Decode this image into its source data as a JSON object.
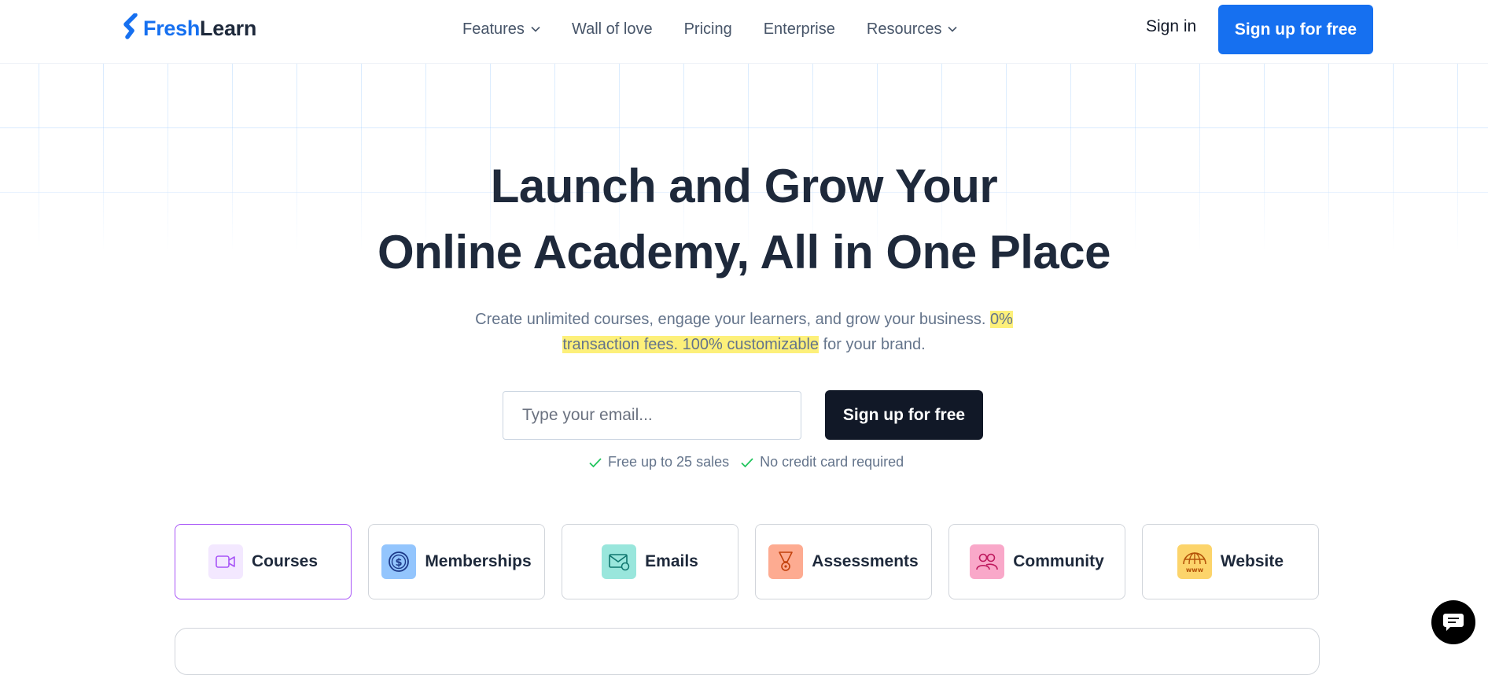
{
  "brand": {
    "name_part1": "Fresh",
    "name_part2": "Learn",
    "primary_color": "#1670f0",
    "dark_color": "#1e293b"
  },
  "nav": {
    "items": [
      {
        "label": "Features",
        "has_dropdown": true
      },
      {
        "label": "Wall of love",
        "has_dropdown": false
      },
      {
        "label": "Pricing",
        "has_dropdown": false
      },
      {
        "label": "Enterprise",
        "has_dropdown": false
      },
      {
        "label": "Resources",
        "has_dropdown": true
      }
    ],
    "sign_in": "Sign in",
    "cta": "Sign up for free"
  },
  "hero": {
    "title_line1": "Launch and Grow Your",
    "title_line2": "Online Academy, All in One Place",
    "subtitle_plain": "Create unlimited courses, engage your learners, and grow your business. ",
    "subtitle_highlight": "0% transaction fees. 100% customizable",
    "subtitle_tail": " for your brand.",
    "highlight_color": "#fdf07a"
  },
  "signup": {
    "email_placeholder": "Type your email...",
    "button": "Sign up for free",
    "checks": [
      "Free up to 25 sales",
      "No credit card required"
    ]
  },
  "features": [
    {
      "label": "Courses",
      "icon": "video-camera-icon",
      "bg": "#f3e8ff",
      "active": true
    },
    {
      "label": "Memberships",
      "icon": "dollar-coin-icon",
      "bg": "#93c5fd",
      "active": false
    },
    {
      "label": "Emails",
      "icon": "envelope-icon",
      "bg": "#99e6dc",
      "active": false
    },
    {
      "label": "Assessments",
      "icon": "trophy-icon",
      "bg": "#fdab91",
      "active": false
    },
    {
      "label": "Community",
      "icon": "users-icon",
      "bg": "#f9a8c9",
      "active": false
    },
    {
      "label": "Website",
      "icon": "globe-www-icon",
      "bg": "#fcd46b",
      "active": false
    }
  ],
  "chat": {
    "icon": "chat-bubble-icon"
  }
}
